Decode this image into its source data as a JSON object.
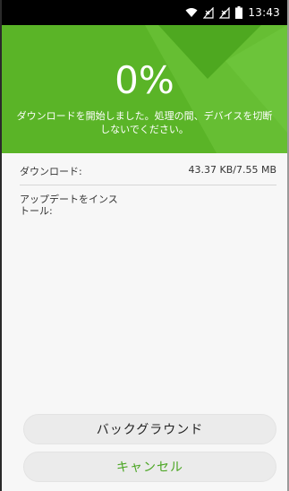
{
  "status_bar": {
    "time": "13:43",
    "icons": [
      "wifi-icon",
      "sim-no-signal-icon",
      "sim-no-signal-icon",
      "battery-icon"
    ]
  },
  "header": {
    "progress_percent": 0,
    "progress_text": "0%",
    "message": "ダウンロードを開始しました。処理の間、デバイスを切断しないでください。",
    "background_color": "#5ab427"
  },
  "details": {
    "download_label": "ダウンロード:",
    "download_value": "43.37 KB/7.55 MB",
    "install_label": "アップデートをインストール:"
  },
  "buttons": {
    "background_label": "バックグラウンド",
    "cancel_label": "キャンセル",
    "cancel_color": "#4aa522"
  }
}
